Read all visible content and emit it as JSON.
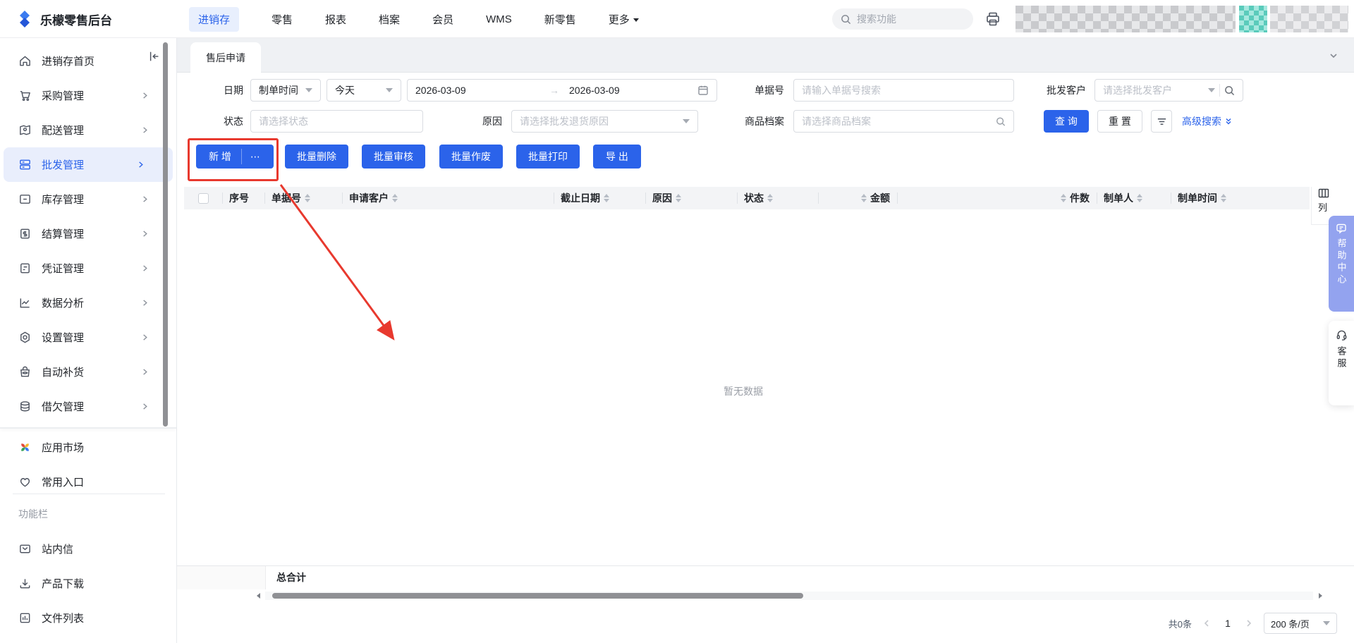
{
  "topbar": {
    "logo": "乐檬零售后台",
    "nav": [
      "进销存",
      "零售",
      "报表",
      "档案",
      "会员",
      "WMS",
      "新零售",
      "更多"
    ],
    "search_placeholder": "搜索功能"
  },
  "sidebar": {
    "items": [
      {
        "label": "进销存首页"
      },
      {
        "label": "采购管理"
      },
      {
        "label": "配送管理"
      },
      {
        "label": "批发管理"
      },
      {
        "label": "库存管理"
      },
      {
        "label": "结算管理"
      },
      {
        "label": "凭证管理"
      },
      {
        "label": "数据分析"
      },
      {
        "label": "设置管理"
      },
      {
        "label": "自动补货"
      },
      {
        "label": "借欠管理"
      }
    ],
    "apps": [
      {
        "label": "应用市场"
      },
      {
        "label": "常用入口"
      }
    ],
    "section": "功能栏",
    "tools": [
      {
        "label": "站内信"
      },
      {
        "label": "产品下载"
      },
      {
        "label": "文件列表"
      }
    ]
  },
  "tab": {
    "title": "售后申请"
  },
  "filters": {
    "date_label": "日期",
    "date_type_value": "制单时间",
    "date_preset_value": "今天",
    "date_from": "2026-03-09",
    "date_to": "2026-03-09",
    "date_separator": "→",
    "order_no_label": "单据号",
    "order_no_placeholder": "请输入单据号搜索",
    "customer_label": "批发客户",
    "customer_placeholder": "请选择批发客户",
    "status_label": "状态",
    "status_placeholder": "请选择状态",
    "reason_label": "原因",
    "reason_placeholder": "请选择批发退货原因",
    "product_label": "商品档案",
    "product_placeholder": "请选择商品档案",
    "search_button": "查 询",
    "reset_button": "重 置",
    "advanced_search": "高级搜索"
  },
  "toolbar": {
    "add": "新 增",
    "more": "⋯",
    "batch_delete": "批量删除",
    "batch_audit": "批量审核",
    "batch_void": "批量作废",
    "batch_print": "批量打印",
    "export": "导 出"
  },
  "table": {
    "columns": [
      {
        "label": "序号"
      },
      {
        "label": "单据号"
      },
      {
        "label": "申请客户"
      },
      {
        "label": "截止日期"
      },
      {
        "label": "原因"
      },
      {
        "label": "状态"
      },
      {
        "label": "金额"
      },
      {
        "label": "件数"
      },
      {
        "label": "制单人"
      },
      {
        "label": "制单时间"
      }
    ],
    "empty": "暂无数据",
    "footer_total": "总合计",
    "column_tool": "列"
  },
  "pagination": {
    "total": "共0条",
    "page": "1",
    "page_size": "200 条/页"
  },
  "widgets": {
    "help": "帮助中心",
    "service": "客服"
  },
  "colors": {
    "primary": "#2b63ea",
    "annotation_red": "#e8392e",
    "help_tab": "#93a3ef",
    "active_bg": "#e9eefc"
  }
}
